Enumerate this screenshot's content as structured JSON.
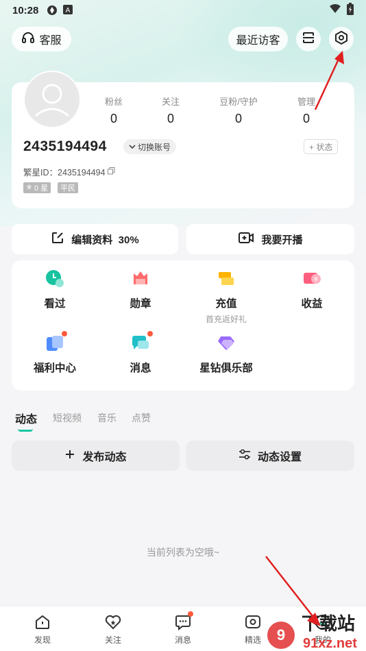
{
  "status_bar": {
    "time": "10:28"
  },
  "top": {
    "service_label": "客服",
    "visitors_label": "最近访客"
  },
  "profile": {
    "stats": [
      {
        "label": "粉丝",
        "value": "0"
      },
      {
        "label": "关注",
        "value": "0"
      },
      {
        "label": "豆粉/守护",
        "value": "0"
      },
      {
        "label": "管理",
        "value": "0"
      }
    ],
    "uid": "2435194494",
    "switch_label": "切换账号",
    "state_label": "+ 状态",
    "xid": "繁星ID：2435194494",
    "badge_star": "0 星",
    "badge_level": "平民"
  },
  "actions": {
    "edit_label": "编辑资料",
    "edit_percent": "30%",
    "live_label": "我要开播"
  },
  "grid": [
    {
      "label": "看过",
      "sub": "",
      "color": "#19c3a0"
    },
    {
      "label": "勋章",
      "sub": "",
      "color": "#ff6b6b"
    },
    {
      "label": "充值",
      "sub": "首充返好礼",
      "color": "#ffb300"
    },
    {
      "label": "收益",
      "sub": "",
      "color": "#ff5f7e"
    },
    {
      "label": "福利中心",
      "sub": "",
      "color": "#4f8dff"
    },
    {
      "label": "消息",
      "sub": "",
      "color": "#21bfc9"
    },
    {
      "label": "星钻俱乐部",
      "sub": "",
      "color": "#9b6bff"
    }
  ],
  "tabs": [
    "动态",
    "短视频",
    "音乐",
    "点赞"
  ],
  "feed": {
    "publish_label": "发布动态",
    "settings_label": "动态设置",
    "empty_text": "当前列表为空哦~"
  },
  "nav": [
    "发现",
    "关注",
    "消息",
    "精选",
    "我的"
  ],
  "watermark": {
    "text": "下载站",
    "domain": "91xz.net"
  },
  "colors": {
    "accent": "#18c7a4",
    "arrow": "#e02020",
    "dot": "#ff5a3c"
  }
}
